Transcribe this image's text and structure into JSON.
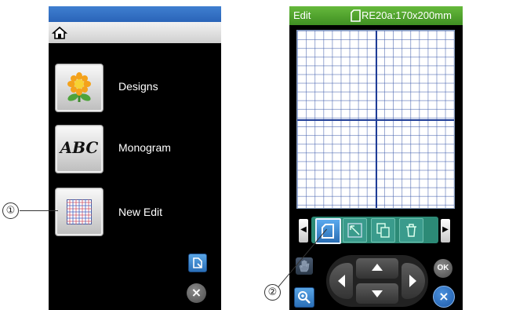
{
  "left_screen": {
    "menu": [
      {
        "label": "Designs",
        "icon": "sunflower-icon"
      },
      {
        "label": "Monogram",
        "icon": "abc-monogram-icon",
        "icon_text": "ABC"
      },
      {
        "label": "New Edit",
        "icon": "grid-edit-icon"
      }
    ],
    "home_icon": "home-icon",
    "bottom_buttons": [
      {
        "icon": "edit-mode-icon"
      },
      {
        "icon": "close-icon",
        "glyph": "×"
      }
    ]
  },
  "right_screen": {
    "mode_label": "Edit",
    "hoop_label": "RE20a:170x200mm",
    "hoop_icon": "hoop-icon",
    "toolbar": [
      {
        "icon": "hoop-select-icon",
        "selected": true
      },
      {
        "icon": "layout-icon",
        "selected": false
      },
      {
        "icon": "copy-icon",
        "selected": false
      },
      {
        "icon": "delete-icon",
        "selected": false
      }
    ],
    "toolbar_arrows": {
      "left": "◀",
      "right": "▶"
    },
    "bottom": {
      "hand_icon": "hand-icon",
      "zoom_icon": "zoom-icon",
      "ok_label": "OK",
      "close_glyph": "×"
    }
  },
  "callouts": [
    {
      "number": "①"
    },
    {
      "number": "②"
    }
  ],
  "colors": {
    "left_topbar": "#2a64b8",
    "right_topbar": "#3f8f22",
    "screen_bg": "#000000",
    "grid_line": "#5a7ab0",
    "grid_center": "#1e3c96",
    "toolbar_active": "#2f6ea8",
    "toolbar_inactive": "#2f7a78"
  }
}
